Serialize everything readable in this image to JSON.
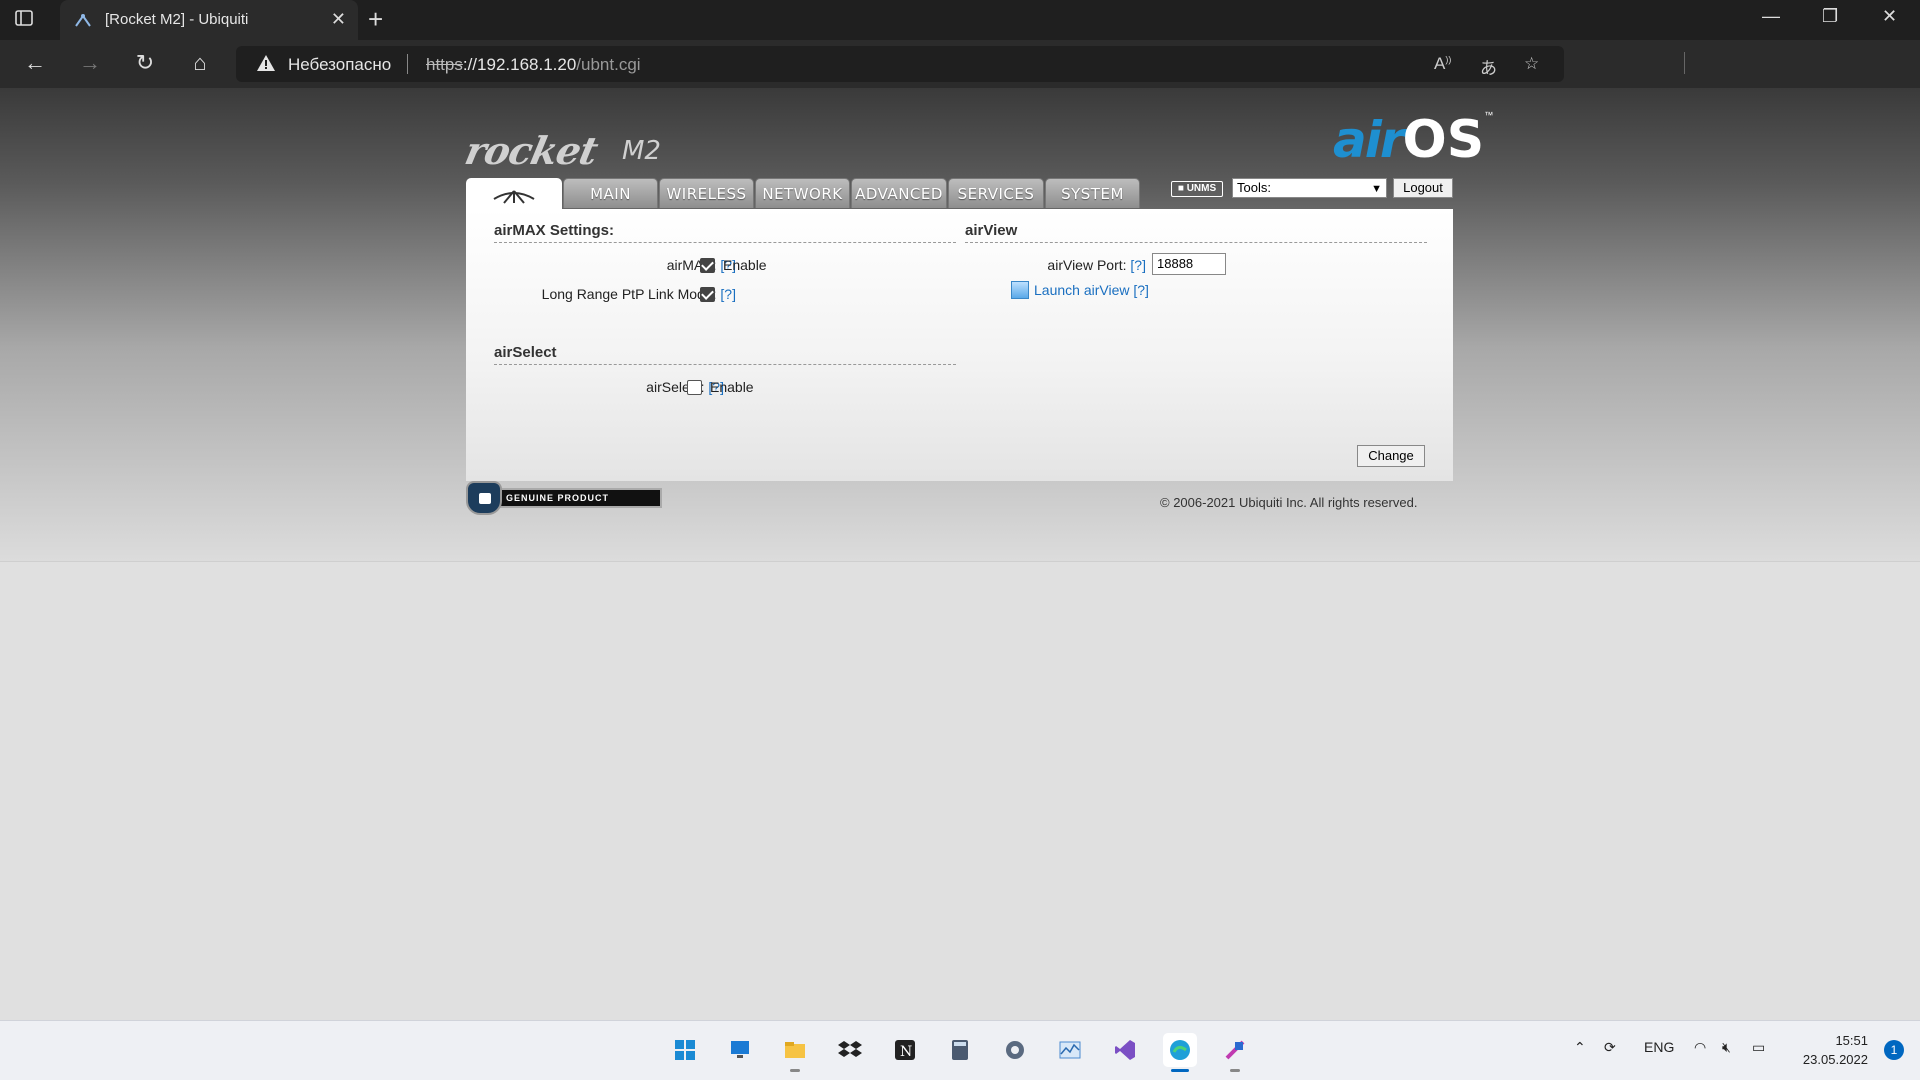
{
  "browser": {
    "tab_title": "[Rocket M2] - Ubiquiti",
    "security_label": "Небезопасно",
    "url_scheme": "https",
    "url_host": "://192.168.1.20",
    "url_path": "/ubnt.cgi"
  },
  "header": {
    "logo_product": "rocket",
    "logo_model": "M2",
    "logo_os_prefix": "air",
    "logo_os_suffix": "OS",
    "logo_tm": "™",
    "nav_tabs": [
      "MAIN",
      "WIRELESS",
      "NETWORK",
      "ADVANCED",
      "SERVICES",
      "SYSTEM"
    ],
    "unms_label": "UNMS",
    "tools_selected": "Tools:",
    "logout_label": "Logout"
  },
  "airmax": {
    "title": "airMAX Settings:",
    "airmax_label": "airMAX:",
    "airmax_help": "[?]",
    "airmax_enabled": true,
    "airmax_option": "Enable",
    "ptp_label": "Long Range PtP Link Mode:",
    "ptp_help": "[?]",
    "ptp_enabled": true
  },
  "airselect": {
    "title": "airSelect",
    "label": "airSelect:",
    "help": "[?]",
    "enabled": false,
    "option": "Enable"
  },
  "airview": {
    "title": "airView",
    "port_label": "airView Port:",
    "port_help": "[?]",
    "port_value": "18888",
    "launch_label": "Launch airView",
    "launch_help": "[?]"
  },
  "footer": {
    "change_label": "Change",
    "genuine_label": "GENUINE  PRODUCT",
    "copyright": "© 2006-2021 Ubiquiti Inc. All rights reserved."
  },
  "taskbar": {
    "apps": [
      "start-icon",
      "remote-desktop-icon",
      "file-explorer-icon",
      "dropbox-icon",
      "notion-icon",
      "calculator-icon",
      "settings-icon",
      "resource-monitor-icon",
      "visual-studio-icon",
      "edge-icon",
      "app-icon"
    ],
    "language": "ENG",
    "time": "15:51",
    "date": "23.05.2022",
    "notification_count": "1"
  },
  "colors": {
    "accent": "#1e8fd0",
    "link": "#1a6fc0",
    "taskbar_accent": "#0067c0"
  }
}
